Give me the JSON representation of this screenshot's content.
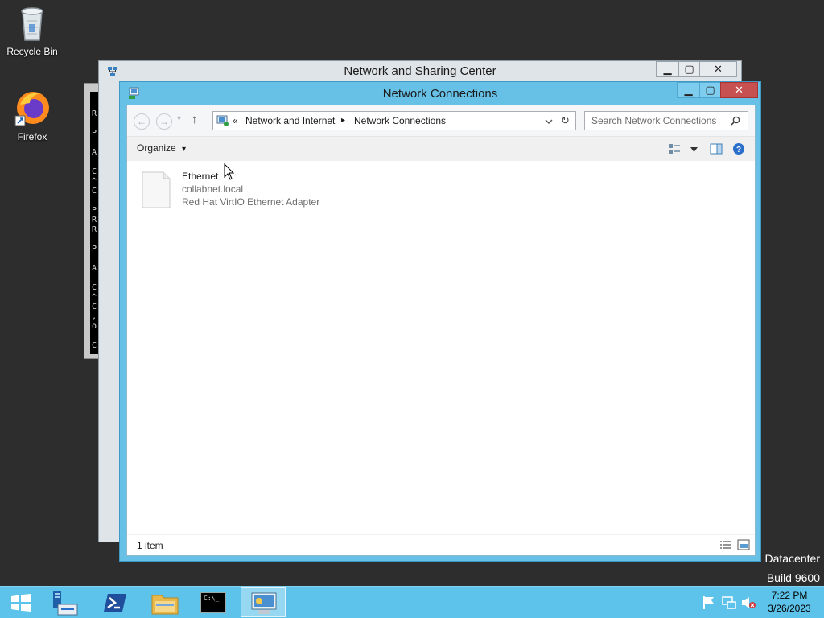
{
  "desktop": {
    "icons": [
      {
        "label": "Recycle Bin",
        "icon": "recycle-bin-icon"
      },
      {
        "label": "Firefox",
        "icon": "firefox-icon"
      }
    ],
    "watermark": {
      "line1": "Datacenter",
      "line2": "Build 9600"
    }
  },
  "background_window": {
    "title": "Network and Sharing Center",
    "controls": {
      "minimize": "▁",
      "maximize": "▢",
      "close": "✕"
    }
  },
  "console_chars": [
    "R",
    "P",
    "A",
    "C",
    "^",
    "C",
    "P",
    "R",
    "R",
    "P",
    "A",
    "C",
    "^",
    "C",
    ",",
    "o",
    "C"
  ],
  "window": {
    "title": "Network Connections",
    "controls": {
      "minimize": "▁",
      "maximize": "▢",
      "close": "✕"
    },
    "nav": {
      "back": "←",
      "forward": "→",
      "dropdown": "▾",
      "up": "↑",
      "breadcrumb_prefix": "«",
      "breadcrumbs": [
        "Network and Internet",
        "Network Connections"
      ],
      "separator": "▸",
      "refresh": "↻",
      "search_placeholder": "Search Network Connections"
    },
    "toolbar": {
      "organize": "Organize",
      "organize_arrow": "▾"
    },
    "items": [
      {
        "name": "Ethernet",
        "network": "collabnet.local",
        "adapter": "Red Hat VirtIO Ethernet Adapter"
      }
    ],
    "status": {
      "count": "1 item"
    }
  },
  "taskbar": {
    "apps": [
      {
        "name": "start",
        "icon": "windows-logo-icon"
      },
      {
        "name": "server-manager",
        "icon": "server-manager-icon"
      },
      {
        "name": "powershell",
        "icon": "powershell-icon"
      },
      {
        "name": "file-explorer",
        "icon": "folder-icon"
      },
      {
        "name": "command-prompt",
        "icon": "cmd-icon",
        "text": "C:\\_"
      },
      {
        "name": "network-connections",
        "icon": "network-connections-icon"
      }
    ],
    "clock": {
      "time": "7:22 PM",
      "date": "3/26/2023"
    }
  }
}
